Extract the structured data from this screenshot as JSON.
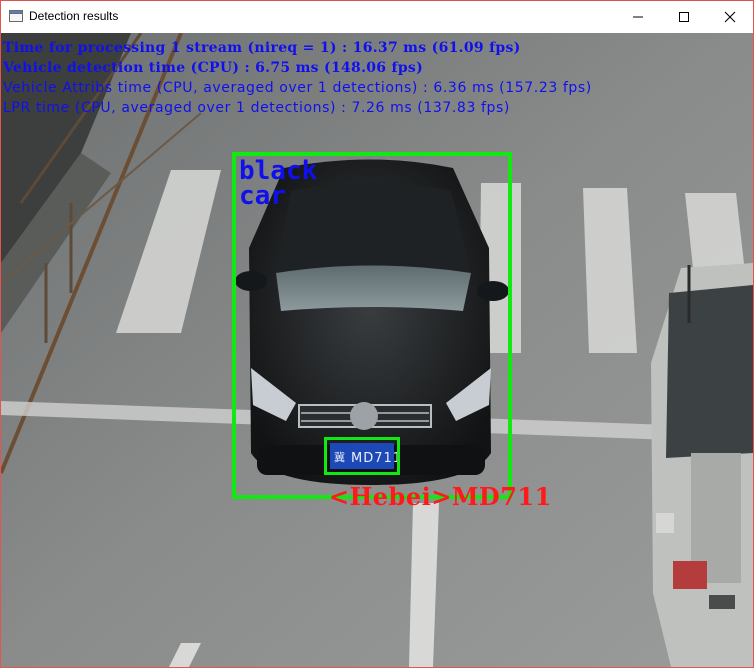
{
  "window": {
    "title": "Detection results",
    "controls": {
      "minimize": "minimize-icon",
      "maximize": "maximize-icon",
      "close": "close-icon"
    }
  },
  "overlay": {
    "stats": [
      "Time for processing 1 stream (nireq = 1) : 16.37 ms (61.09 fps)",
      "Vehicle detection time (CPU) : 6.75 ms (148.06 fps)",
      "Vehicle Attribs time (CPU, averaged over 1 detections) : 6.36 ms (157.23 fps)",
      "LPR time (CPU, averaged over 1 detections) : 7.26 ms (137.83 fps)"
    ],
    "vehicle": {
      "color": "black",
      "type": "car"
    },
    "plate": {
      "label": "<Hebei>MD711",
      "text": "MD711",
      "province_char": "冀"
    }
  },
  "colors": {
    "detection_box": "#12e812",
    "stats_text": "#1010ee",
    "plate_text": "#ff1a1a"
  }
}
